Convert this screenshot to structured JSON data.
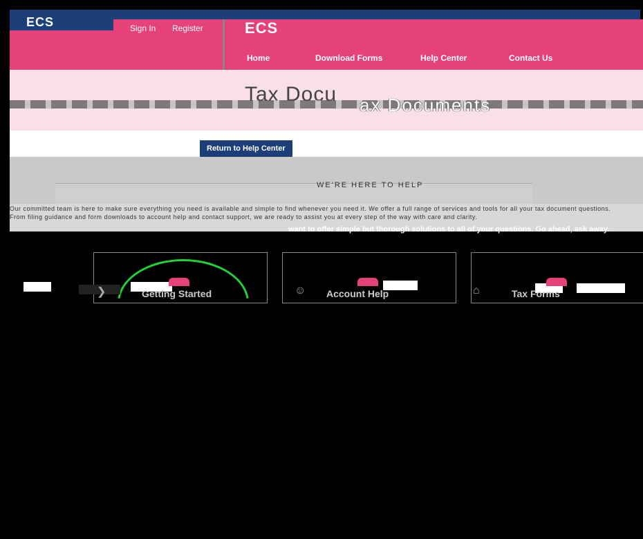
{
  "header": {
    "small_logo": "ECS",
    "sign_in": "Sign In",
    "register": "Register",
    "brand": "ECS",
    "nav": [
      "Home",
      "Download Forms",
      "Help Center",
      "Contact Us"
    ]
  },
  "hero": {
    "title_left": "Tax Docu",
    "title_right": "ax Documents"
  },
  "return_button": "Return to Help Center",
  "welcome": "WE'RE HERE TO HELP",
  "intro": {
    "line1": "Our committed team is here to make sure everything you need is available and simple to find whenever you need it. We offer a full range of services and tools for all your tax document questions.",
    "line2": "From filing guidance and form downloads to account help and contact support, we are ready to assist you at every step of the way with care and clarity.",
    "line3": "want to offer simple but thorough solutions to all of your questions. Go ahead, ask away."
  },
  "cards": [
    {
      "label": "Getting Started",
      "icon": "rocket-icon"
    },
    {
      "label": "Account Help",
      "icon": "user-icon"
    },
    {
      "label": "Tax Forms",
      "icon": "document-icon"
    }
  ],
  "colors": {
    "brand_pink": "#e5427a",
    "navy": "#1c3f7a",
    "hero_bg": "#f9dfe8",
    "accent_green": "#22d03a"
  }
}
